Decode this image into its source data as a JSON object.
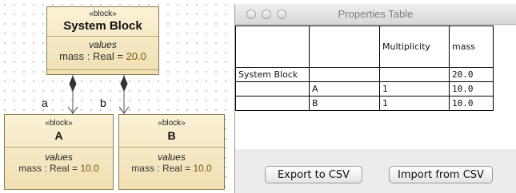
{
  "diagram": {
    "stereotype": "«block»",
    "compartment_label": "values",
    "system_block": {
      "name": "System Block",
      "prop_name": "mass : Real = ",
      "prop_value": "20.0"
    },
    "block_a": {
      "name": "A",
      "prop_name": "mass : Real = ",
      "prop_value": "10.0"
    },
    "block_b": {
      "name": "B",
      "prop_name": "mass : Real = ",
      "prop_value": "10.0"
    },
    "role_a": "a",
    "role_b": "b"
  },
  "window": {
    "title": "Properties Table",
    "table": {
      "headers": [
        "",
        "",
        "Multiplicity",
        "mass"
      ],
      "rows": [
        [
          "System Block",
          "",
          "",
          "20.0"
        ],
        [
          "",
          "A",
          "1",
          "10.0"
        ],
        [
          "",
          "B",
          "1",
          "10.0"
        ]
      ]
    },
    "export_button": "Export to CSV",
    "import_button": "Import from CSV"
  },
  "colors": {
    "block_fill": "#f5e9c4",
    "value_text": "#7a5a10"
  }
}
